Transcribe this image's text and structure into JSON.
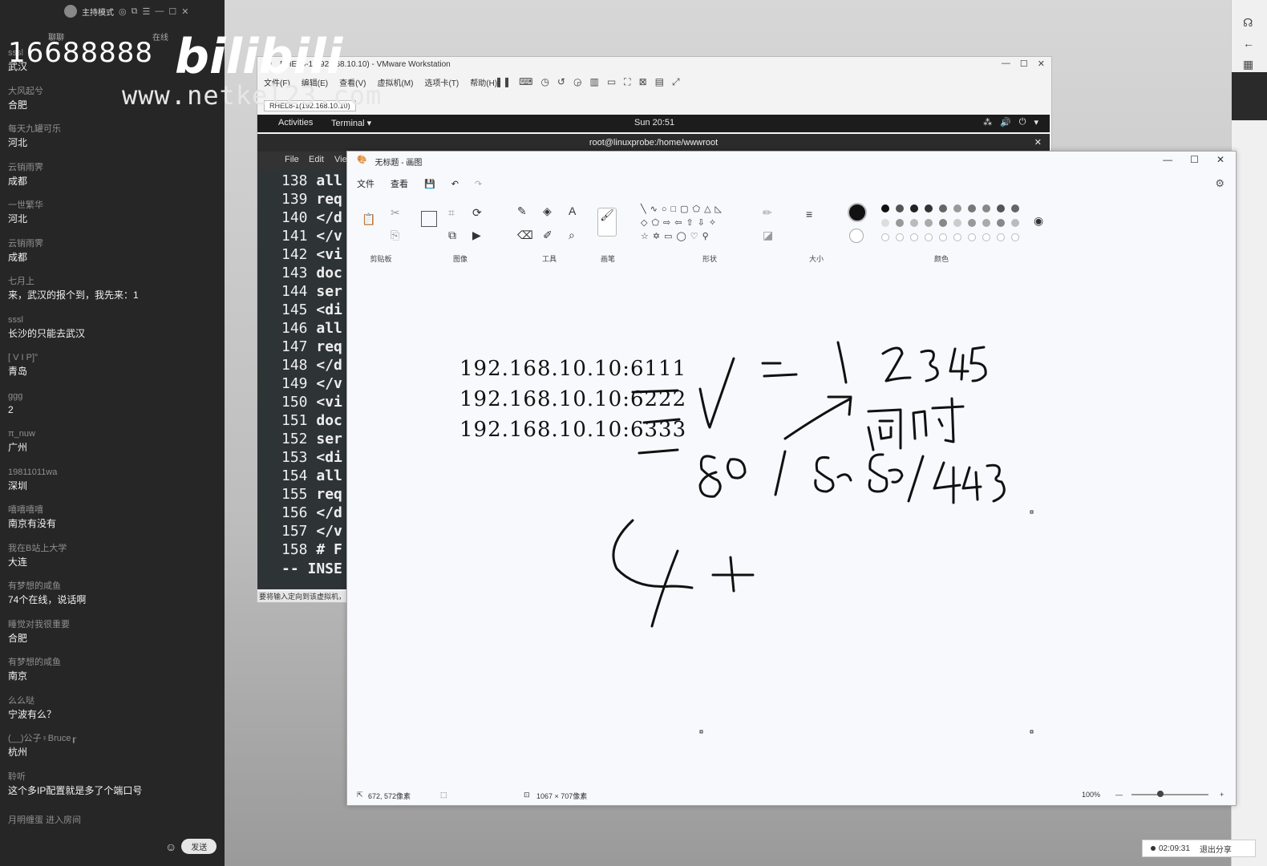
{
  "chat": {
    "mode_label": "主持模式",
    "tabs": [
      "聊聊",
      "在线"
    ],
    "messages": [
      {
        "user": "sssl",
        "text": "武汉"
      },
      {
        "user": "大风起兮",
        "text": "合肥"
      },
      {
        "user": "每天九罐可乐",
        "text": "河北"
      },
      {
        "user": "云销雨霁",
        "text": "成都"
      },
      {
        "user": "一世繁华",
        "text": "河北"
      },
      {
        "user": "云销雨霁",
        "text": "成都"
      },
      {
        "user": "七月上",
        "text": "来，武汉的报个到，我先来：1"
      },
      {
        "user": "sssl",
        "text": "长沙的只能去武汉"
      },
      {
        "user": "[    V    I    P]°",
        "text": "青岛"
      },
      {
        "user": "ggg",
        "text": "2"
      },
      {
        "user": "π_nuw",
        "text": "广州"
      },
      {
        "user": "19811011wa",
        "text": "深圳"
      },
      {
        "user": "嘻嘻嘻嘻",
        "text": "南京有没有"
      },
      {
        "user": "我在B站上大学",
        "text": "大连"
      },
      {
        "user": "有梦想的咸鱼",
        "text": "74个在线，说话啊"
      },
      {
        "user": "睡觉对我很重要",
        "text": "合肥"
      },
      {
        "user": "有梦想的咸鱼",
        "text": "南京"
      },
      {
        "user": "么么哒",
        "text": "宁波有么？"
      },
      {
        "user": "(__)公子♀Bruce┎",
        "text": "杭州"
      },
      {
        "user": "聆听",
        "text": "这个多IP配置就是多了个端口号"
      }
    ],
    "notice": "月明缠蛋 进入房间",
    "send_label": "发送"
  },
  "watermark": {
    "number": "16688888",
    "logo": "bilibili",
    "url": "www.netkel23.com"
  },
  "vmware": {
    "title": "RHEL8-1(192.168.10.10) - VMware Workstation",
    "menu": [
      "文件(F)",
      "编辑(E)",
      "查看(V)",
      "虚拟机(M)",
      "选项卡(T)",
      "帮助(H)"
    ],
    "tab": "RHEL8-1(192.168.10.10)",
    "status": "要将输入定向到该虚拟机，"
  },
  "gnome": {
    "activities": "Activities",
    "app": "Terminal ▾",
    "clock": "Sun 20:51"
  },
  "terminal": {
    "title": "root@linuxprobe:/home/wwwroot",
    "menu": [
      "File",
      "Edit",
      "Vie"
    ],
    "lines": [
      {
        "n": "138",
        "c": "all"
      },
      {
        "n": "139",
        "c": "req"
      },
      {
        "n": "140",
        "c": "</d"
      },
      {
        "n": "141",
        "c": "</v"
      },
      {
        "n": "142",
        "c": "<vi"
      },
      {
        "n": "143",
        "c": "doc"
      },
      {
        "n": "144",
        "c": "ser"
      },
      {
        "n": "145",
        "c": "<di"
      },
      {
        "n": "146",
        "c": "all"
      },
      {
        "n": "147",
        "c": "req"
      },
      {
        "n": "148",
        "c": "</d"
      },
      {
        "n": "149",
        "c": "</v"
      },
      {
        "n": "150",
        "c": "<vi"
      },
      {
        "n": "151",
        "c": "doc"
      },
      {
        "n": "152",
        "c": "ser"
      },
      {
        "n": "153",
        "c": "<di"
      },
      {
        "n": "154",
        "c": "all"
      },
      {
        "n": "155",
        "c": "req"
      },
      {
        "n": "156",
        "c": "</d"
      },
      {
        "n": "157",
        "c": "</v"
      },
      {
        "n": "158",
        "c": "# F"
      }
    ],
    "mode": "-- INSE"
  },
  "paint": {
    "title": "无标题 - 画图",
    "menu": [
      "文件",
      "查看"
    ],
    "groups": [
      "剪贴板",
      "图像",
      "工具",
      "画笔",
      "形状",
      "大小",
      "颜色"
    ],
    "canvas_lines": [
      "192.168.10.10:6111",
      "192.168.10.10:6222",
      "192.168.10.10:6333"
    ],
    "status_pos": "672, 572像素",
    "status_size": "1067 × 707像素",
    "zoom": "100%"
  },
  "recording": {
    "time": "02:09:31",
    "exit": "退出分享"
  }
}
